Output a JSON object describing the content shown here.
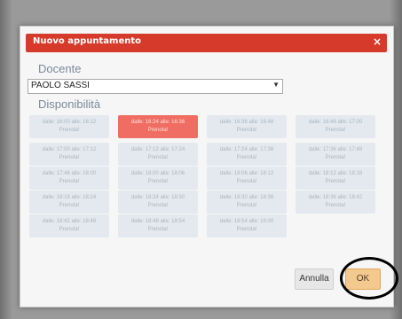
{
  "dialog": {
    "title": "Nuovo appuntamento",
    "close_glyph": "×",
    "docente_label": "Docente",
    "docente_value": "PAOLO SASSI",
    "disponibilita_label": "Disponibilità"
  },
  "slots": [
    {
      "time": "dalle: 16:00 alle: 16:12",
      "status": "Prenota!",
      "selected": false
    },
    {
      "time": "dalle: 16:24 alle: 16:36",
      "status": "Prenota!",
      "selected": true
    },
    {
      "time": "dalle: 16:36 alle: 16:48",
      "status": "Prenota!",
      "selected": false
    },
    {
      "time": "dalle: 16:48 alle: 17:00",
      "status": "Prenota!",
      "selected": false
    },
    {
      "time": "dalle: 17:00 alle: 17:12",
      "status": "Prenota!",
      "selected": false
    },
    {
      "time": "dalle: 17:12 alle: 17:24",
      "status": "Prenota!",
      "selected": false
    },
    {
      "time": "dalle: 17:24 alle: 17:36",
      "status": "Prenota!",
      "selected": false
    },
    {
      "time": "dalle: 17:36 alle: 17:48",
      "status": "Prenota!",
      "selected": false
    },
    {
      "time": "dalle: 17:48 alle: 18:00",
      "status": "Prenota!",
      "selected": false
    },
    {
      "time": "dalle: 18:00 alle: 18:06",
      "status": "Prenota!",
      "selected": false
    },
    {
      "time": "dalle: 18:06 alle: 18:12",
      "status": "Prenota!",
      "selected": false
    },
    {
      "time": "dalle: 18:12 alle: 18:18",
      "status": "Prenota!",
      "selected": false
    },
    {
      "time": "dalle: 18:18 alle: 18:24",
      "status": "Prenota!",
      "selected": false
    },
    {
      "time": "dalle: 18:24 alle: 18:30",
      "status": "Prenota!",
      "selected": false
    },
    {
      "time": "dalle: 18:30 alle: 18:36",
      "status": "Prenota!",
      "selected": false
    },
    {
      "time": "dalle: 18:36 alle: 18:42",
      "status": "Prenota!",
      "selected": false
    },
    {
      "time": "dalle: 18:42 alle: 18:48",
      "status": "Prenota!",
      "selected": false
    },
    {
      "time": "dalle: 18:48 alle: 18:54",
      "status": "Prenota!",
      "selected": false
    },
    {
      "time": "dalle: 18:54 alle: 19:00",
      "status": "Prenota!",
      "selected": false
    }
  ],
  "buttons": {
    "cancel": "Annulla",
    "ok": "OK"
  },
  "colors": {
    "titlebar": "#d63a2a",
    "selected_slot": "#ef6d63",
    "slot": "#e3e9ef",
    "ok_button": "#f4c98d"
  }
}
